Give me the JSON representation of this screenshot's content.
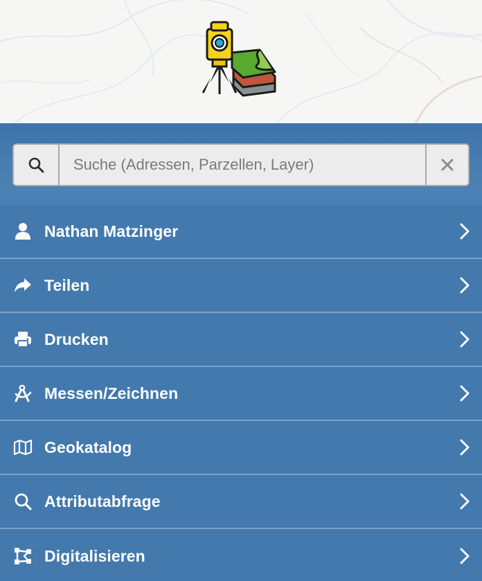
{
  "search": {
    "placeholder": "Suche (Adressen, Parzellen, Layer)",
    "value": ""
  },
  "menu": [
    {
      "label": "Nathan Matzinger",
      "icon": "user-icon"
    },
    {
      "label": "Teilen",
      "icon": "share-icon"
    },
    {
      "label": "Drucken",
      "icon": "print-icon"
    },
    {
      "label": "Messen/Zeichnen",
      "icon": "compass-drafting-icon"
    },
    {
      "label": "Geokatalog",
      "icon": "map-icon"
    },
    {
      "label": "Attributabfrage",
      "icon": "search-icon"
    },
    {
      "label": "Digitalisieren",
      "icon": "draw-polygon-icon"
    }
  ],
  "colors": {
    "panel": "#4379ad",
    "header_bg": "#f6f7f4",
    "separator": "#7ba2c9",
    "text": "#ffffff"
  }
}
